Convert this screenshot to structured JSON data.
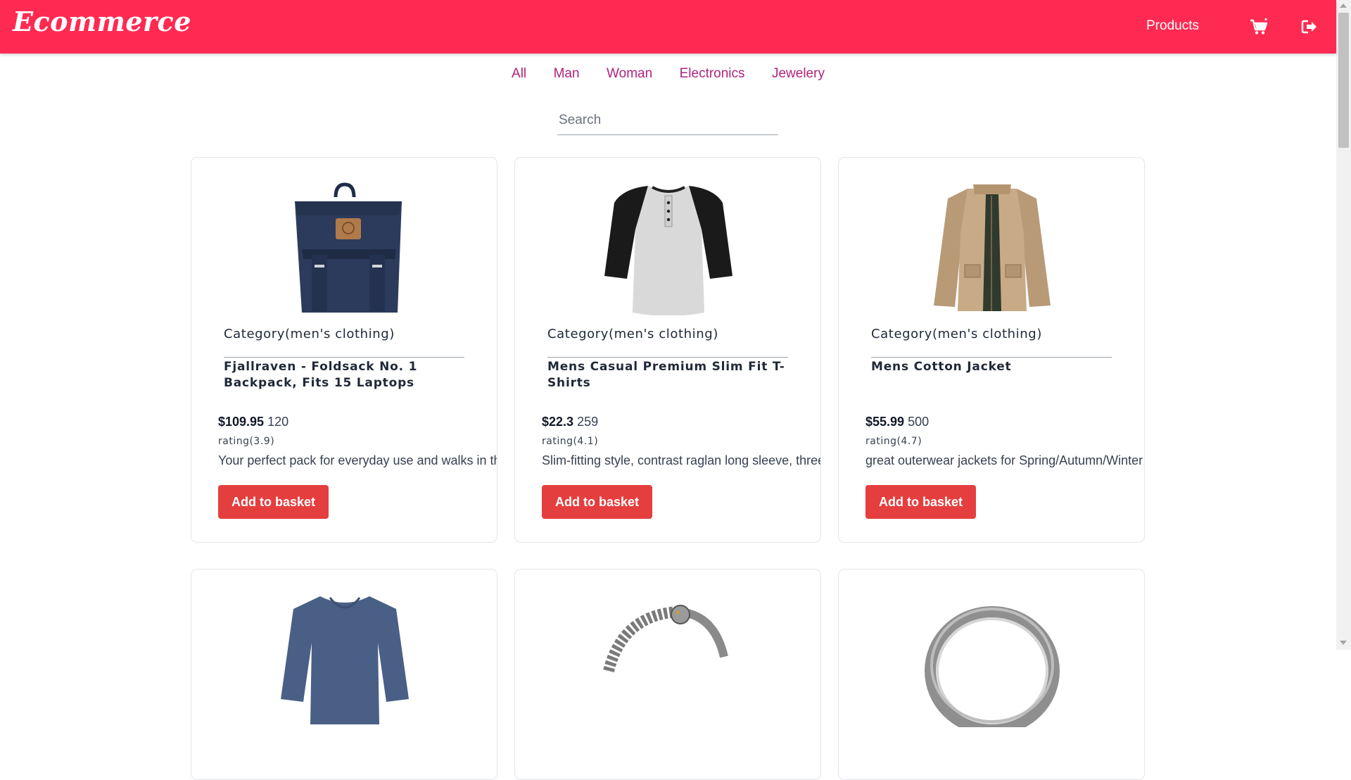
{
  "navbar": {
    "brand": "Ecommerce",
    "products_label": "Products",
    "cart_icon": "cart-icon",
    "logout_icon": "logout-icon",
    "background": "#ff2a52"
  },
  "filters": [
    "All",
    "Man",
    "Woman",
    "Electronics",
    "Jewelery"
  ],
  "search": {
    "placeholder": "Search",
    "value": ""
  },
  "products": [
    {
      "category": "Category(men's clothing)",
      "title": "Fjallraven - Foldsack No. 1 Backpack, Fits 15 Laptops",
      "price": "$109.95",
      "count": "120",
      "rating": "rating(3.9)",
      "description": "Your perfect pack for everyday use and walks in the forest.",
      "button": "Add to basket",
      "image": "backpack-image"
    },
    {
      "category": "Category(men's clothing)",
      "title": "Mens Casual Premium Slim Fit T-Shirts",
      "price": "$22.3",
      "count": "259",
      "rating": "rating(4.1)",
      "description": "Slim-fitting style, contrast raglan long sleeve, three-button henley placket.",
      "button": "Add to basket",
      "image": "raglan-shirt-image"
    },
    {
      "category": "Category(men's clothing)",
      "title": "Mens Cotton Jacket",
      "price": "$55.99",
      "count": "500",
      "rating": "rating(4.7)",
      "description": "great outerwear jackets for Spring/Autumn/Winter",
      "button": "Add to basket",
      "image": "cotton-jacket-image"
    },
    {
      "image": "long-sleeve-tee-image"
    },
    {
      "image": "dragon-bracelet-image"
    },
    {
      "image": "silver-ring-image"
    }
  ],
  "colors": {
    "accent": "#ff2a52",
    "filter_link": "#b0237a",
    "button": "#e53e3e"
  }
}
